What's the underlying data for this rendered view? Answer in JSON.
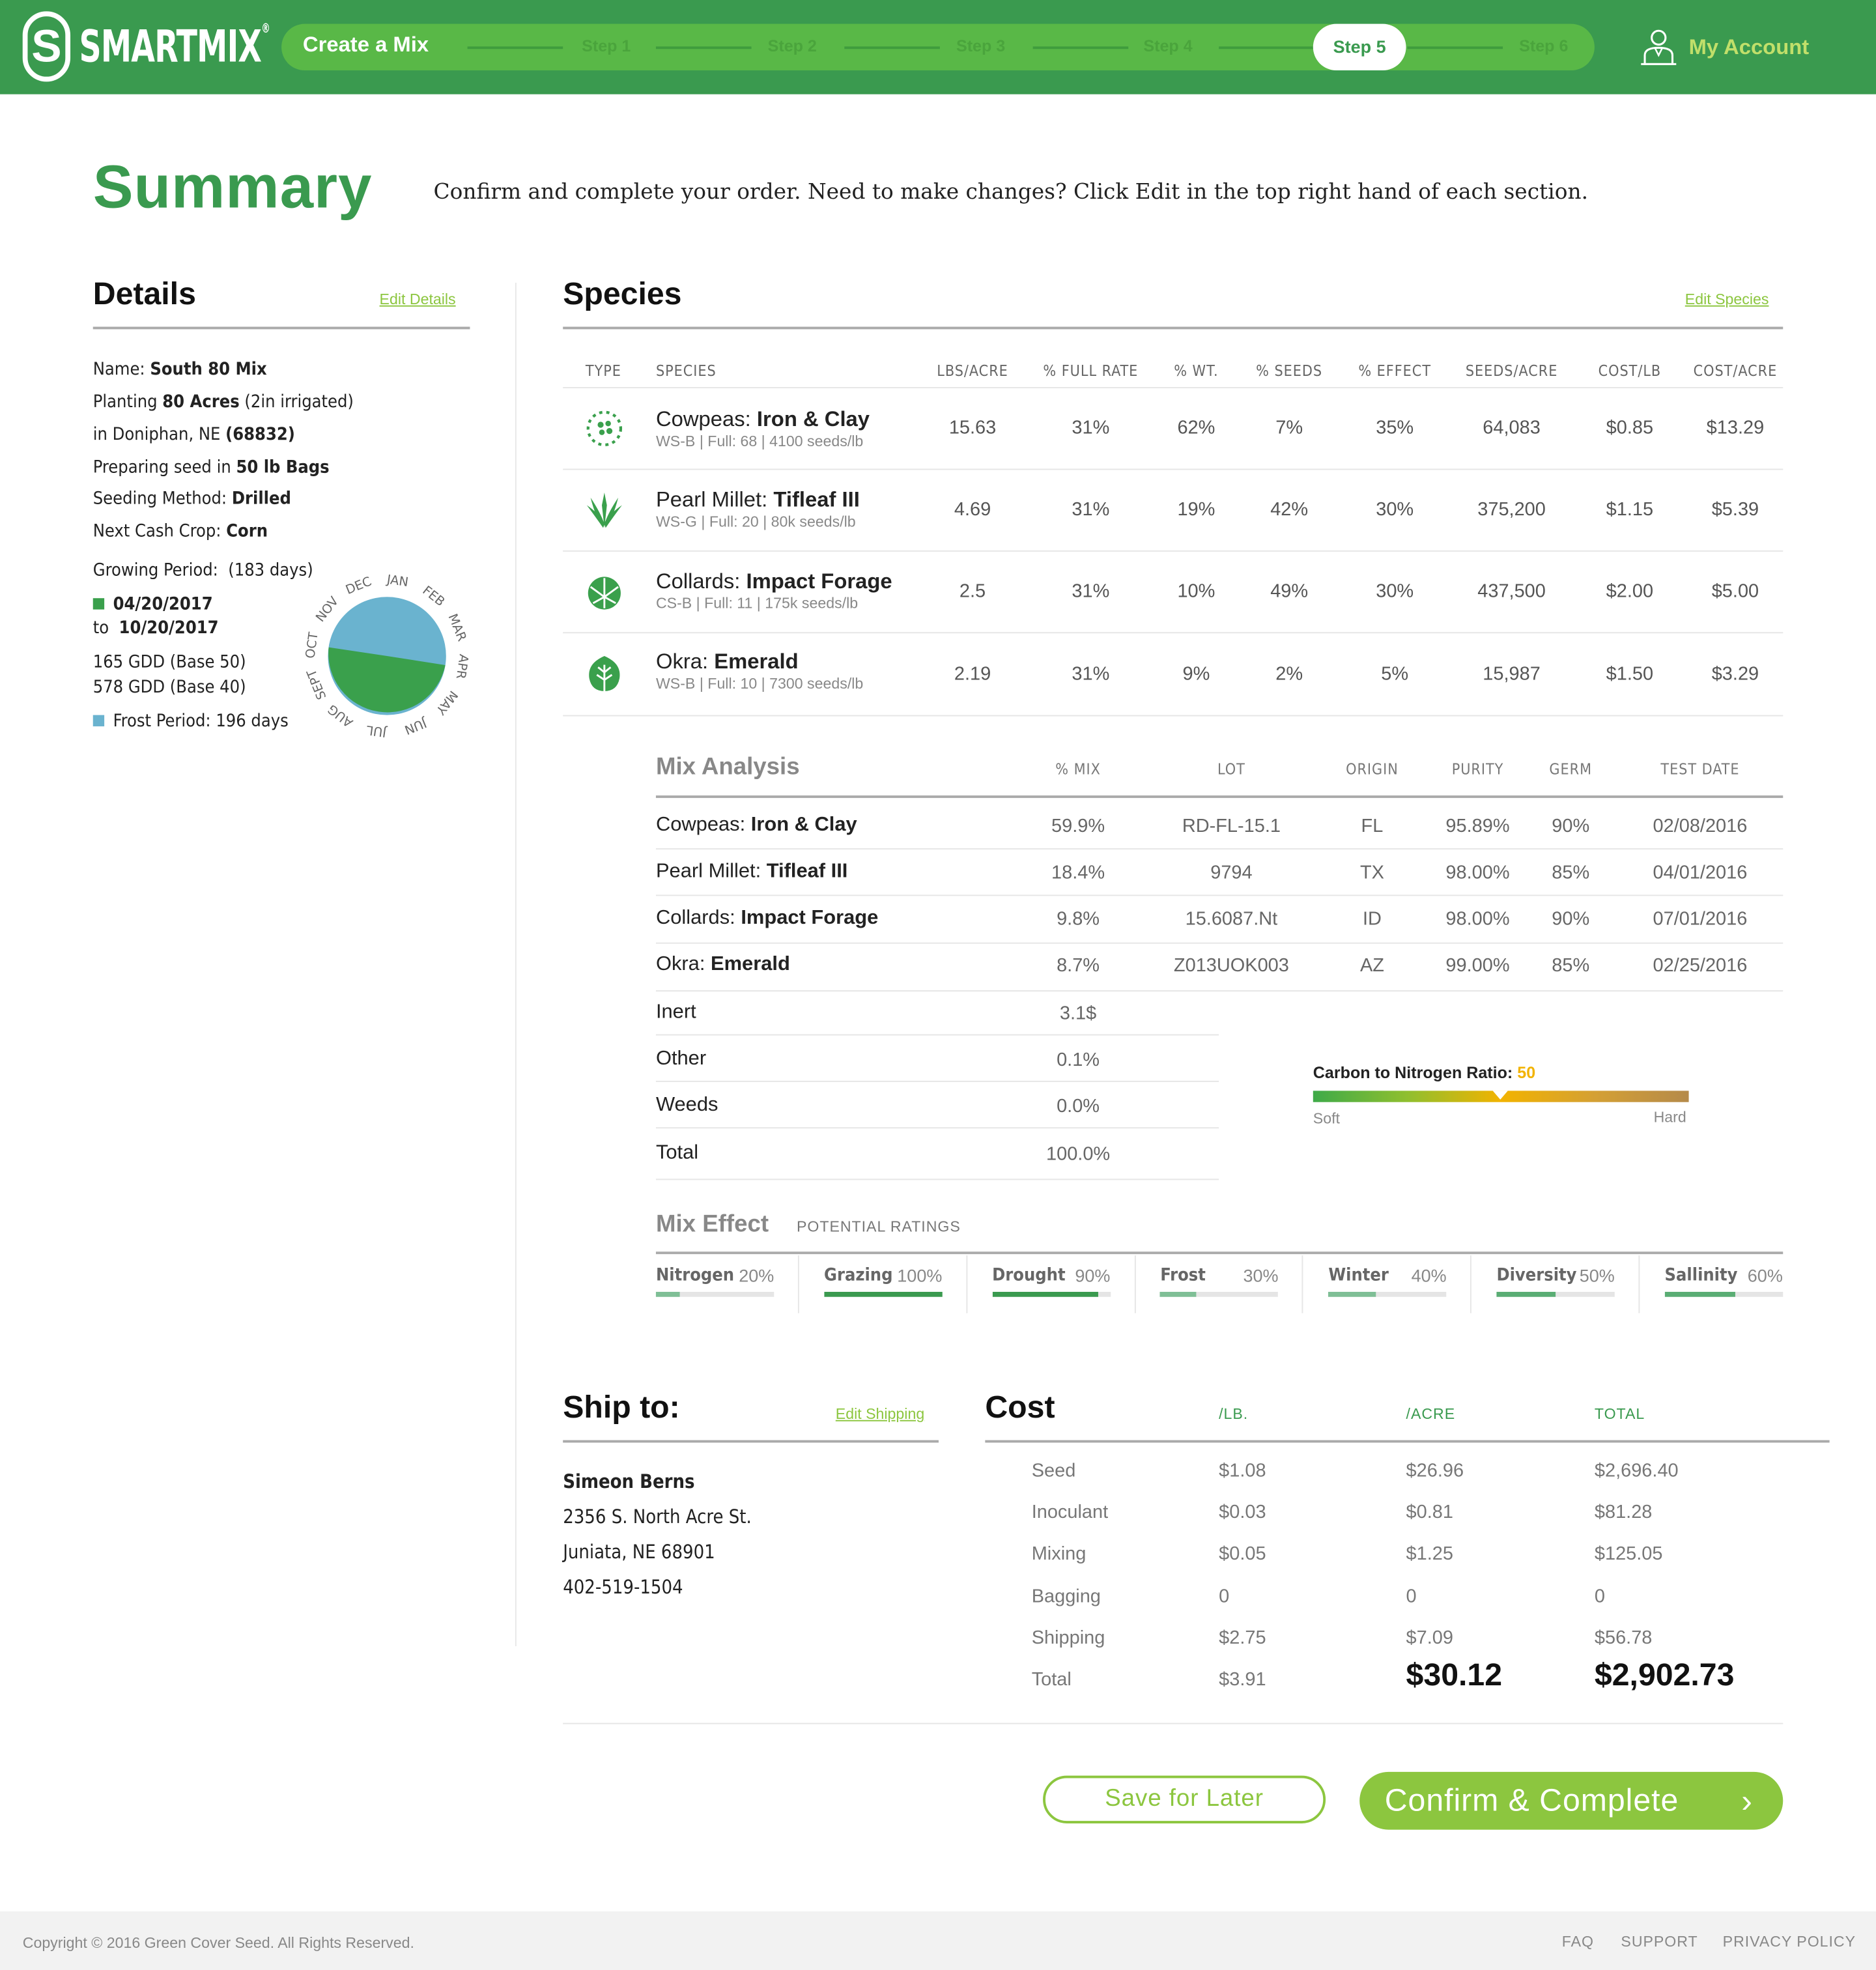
{
  "header": {
    "logo_letter": "S",
    "brand": "SMARTMIX",
    "trademark": "®",
    "stepper_title": "Create a Mix",
    "steps": [
      "Step 1",
      "Step 2",
      "Step 3",
      "Step 4",
      "Step 5",
      "Step 6"
    ],
    "active_step": "Step 5",
    "account_label": "My Account",
    "icons": {
      "logo": "smartmix-s-logo",
      "account": "user-outline-icon"
    }
  },
  "summary": {
    "title": "Summary",
    "subtitle": "Confirm and complete your order. Need to make changes? Click Edit in the top right hand of each section."
  },
  "details": {
    "title": "Details",
    "edit_label": "Edit Details",
    "name_label": "Name:",
    "name_value": "South 80 Mix",
    "planting_label": "Planting",
    "planting_value": "80 Acres",
    "planting_note": "(2in irrigated)",
    "location_label": "in Doniphan, NE",
    "location_zip": "(68832)",
    "bags_label": "Preparing seed in",
    "bags_value": "50 lb Bags",
    "method_label": "Seeding Method:",
    "method_value": "Drilled",
    "crop_label": "Next Cash Crop:",
    "crop_value": "Corn",
    "growing_label": "Growing Period:",
    "growing_days": "(183 days)",
    "start_date": "04/20/2017",
    "to_label": "to",
    "end_date": "10/20/2017",
    "gdd50": "165 GDD (Base 50)",
    "gdd40": "578 GDD (Base 40)",
    "frost": "Frost Period: 196 days",
    "months": [
      "JAN",
      "FEB",
      "MAR",
      "APR",
      "MAY",
      "JUN",
      "JUL",
      "AUG",
      "SEPT",
      "OCT",
      "NOV",
      "DEC"
    ],
    "colors": {
      "growing": "#3aa04c",
      "frost": "#6ab3cf"
    }
  },
  "species": {
    "title": "Species",
    "edit_label": "Edit Species",
    "columns": [
      "TYPE",
      "SPECIES",
      "LBS/ACRE",
      "% FULL RATE",
      "% WT.",
      "% SEEDS",
      "% EFFECT",
      "SEEDS/ACRE",
      "COST/LB",
      "COST/ACRE"
    ],
    "rows": [
      {
        "icon": "legume-dots-icon",
        "common": "Cowpeas:",
        "variety": "Iron & Clay",
        "code": "WS-B",
        "full": "Full: 68",
        "seeds_lb": "4100 seeds/lb",
        "lbs_acre": "15.63",
        "full_rate": "31%",
        "wt": "62%",
        "seeds": "7%",
        "effect": "35%",
        "seeds_acre": "64,083",
        "cost_lb": "$0.85",
        "cost_acre": "$13.29"
      },
      {
        "icon": "grass-icon",
        "common": "Pearl Millet:",
        "variety": "Tifleaf III",
        "code": "WS-G",
        "full": "Full: 20",
        "seeds_lb": "80k seeds/lb",
        "lbs_acre": "4.69",
        "full_rate": "31%",
        "wt": "19%",
        "seeds": "42%",
        "effect": "30%",
        "seeds_acre": "375,200",
        "cost_lb": "$1.15",
        "cost_acre": "$5.39"
      },
      {
        "icon": "brassica-icon",
        "common": "Collards:",
        "variety": "Impact Forage",
        "code": "CS-B",
        "full": "Full: 11",
        "seeds_lb": "175k seeds/lb",
        "lbs_acre": "2.5",
        "full_rate": "31%",
        "wt": "10%",
        "seeds": "49%",
        "effect": "30%",
        "seeds_acre": "437,500",
        "cost_lb": "$2.00",
        "cost_acre": "$5.00"
      },
      {
        "icon": "broadleaf-icon",
        "common": "Okra:",
        "variety": "Emerald",
        "code": "WS-B",
        "full": "Full: 10",
        "seeds_lb": "7300 seeds/lb",
        "lbs_acre": "2.19",
        "full_rate": "31%",
        "wt": "9%",
        "seeds": "2%",
        "effect": "5%",
        "seeds_acre": "15,987",
        "cost_lb": "$1.50",
        "cost_acre": "$3.29"
      }
    ]
  },
  "mix_analysis": {
    "title": "Mix Analysis",
    "columns": [
      "% MIX",
      "LOT",
      "ORIGIN",
      "PURITY",
      "GERM",
      "TEST DATE"
    ],
    "rows": [
      {
        "common": "Cowpeas:",
        "variety": "Iron & Clay",
        "mix": "59.9%",
        "lot": "RD-FL-15.1",
        "origin": "FL",
        "purity": "95.89%",
        "germ": "90%",
        "date": "02/08/2016"
      },
      {
        "common": "Pearl Millet:",
        "variety": "Tifleaf III",
        "mix": "18.4%",
        "lot": "9794",
        "origin": "TX",
        "purity": "98.00%",
        "germ": "85%",
        "date": "04/01/2016"
      },
      {
        "common": "Collards:",
        "variety": "Impact Forage",
        "mix": "9.8%",
        "lot": "15.6087.Nt",
        "origin": "ID",
        "purity": "98.00%",
        "germ": "90%",
        "date": "07/01/2016"
      },
      {
        "common": "Okra:",
        "variety": "Emerald",
        "mix": "8.7%",
        "lot": "Z013UOK003",
        "origin": "AZ",
        "purity": "99.00%",
        "germ": "85%",
        "date": "02/25/2016"
      }
    ],
    "other_rows": [
      {
        "label": "Inert",
        "mix": "3.1$"
      },
      {
        "label": "Other",
        "mix": "0.1%"
      },
      {
        "label": "Weeds",
        "mix": "0.0%"
      },
      {
        "label": "Total",
        "mix": "100.0%"
      }
    ],
    "cn_label": "Carbon to Nitrogen Ratio:",
    "cn_value": "50",
    "cn_soft": "Soft",
    "cn_hard": "Hard",
    "cn_value_color": "#f2b300"
  },
  "mix_effect": {
    "title": "Mix Effect",
    "subtitle": "POTENTIAL RATINGS",
    "items": [
      {
        "name": "Nitrogen",
        "value": "20%",
        "fraction": 0.2,
        "color": "#7fbf96"
      },
      {
        "name": "Grazing",
        "value": "100%",
        "fraction": 1.0,
        "color": "#3a9a4f"
      },
      {
        "name": "Drought",
        "value": "90%",
        "fraction": 0.9,
        "color": "#3a9a4f"
      },
      {
        "name": "Frost",
        "value": "30%",
        "fraction": 0.3,
        "color": "#7fbf96"
      },
      {
        "name": "Winter",
        "value": "40%",
        "fraction": 0.4,
        "color": "#7fbf96"
      },
      {
        "name": "Diversity",
        "value": "50%",
        "fraction": 0.5,
        "color": "#5aad74"
      },
      {
        "name": "Sallinity",
        "value": "60%",
        "fraction": 0.6,
        "color": "#5aad74"
      }
    ]
  },
  "ship": {
    "title": "Ship to:",
    "edit_label": "Edit Shipping",
    "name": "Simeon Berns",
    "street": "2356 S. North Acre St.",
    "city": "Juniata, NE 68901",
    "phone": "402-519-1504"
  },
  "cost": {
    "title": "Cost",
    "columns": [
      "/LB.",
      "/ACRE",
      "TOTAL"
    ],
    "rows": [
      {
        "label": "Seed",
        "lb": "$1.08",
        "acre": "$26.96",
        "total": "$2,696.40"
      },
      {
        "label": "Inoculant",
        "lb": "$0.03",
        "acre": "$0.81",
        "total": "$81.28"
      },
      {
        "label": "Mixing",
        "lb": "$0.05",
        "acre": "$1.25",
        "total": "$125.05"
      },
      {
        "label": "Bagging",
        "lb": "0",
        "acre": "0",
        "total": "0"
      },
      {
        "label": "Shipping",
        "lb": "$2.75",
        "acre": "$7.09",
        "total": "$56.78"
      }
    ],
    "total_label": "Total",
    "total_lb": "$3.91",
    "total_acre": "$30.12",
    "total_total": "$2,902.73"
  },
  "actions": {
    "save_label": "Save for Later",
    "confirm_label": "Confirm & Complete",
    "confirm_arrow": "›"
  },
  "footer": {
    "copyright": "Copyright © 2016 Green Cover Seed. All Rights Reserved.",
    "links": [
      "FAQ",
      "SUPPORT",
      "PRIVACY POLICY"
    ]
  }
}
